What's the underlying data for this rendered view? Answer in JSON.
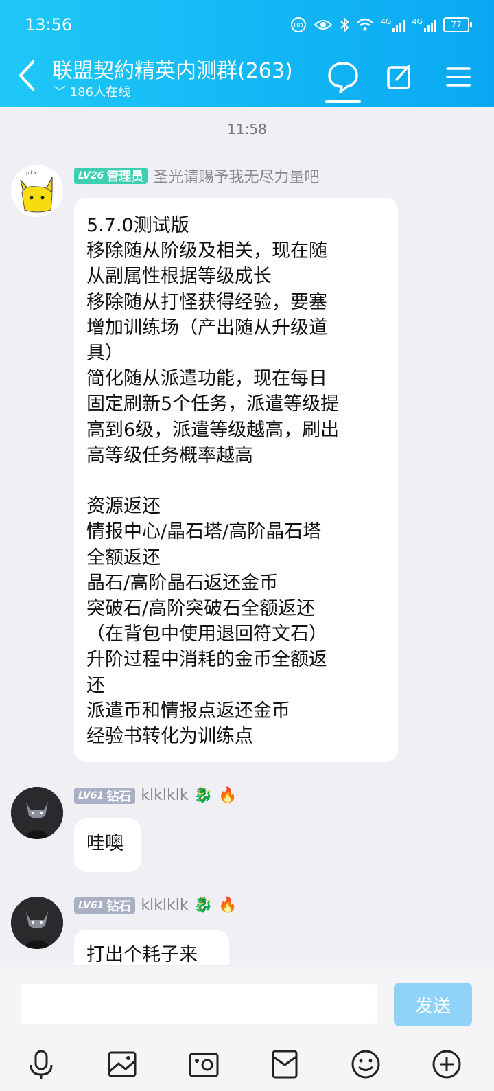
{
  "status_bar": {
    "time": "13:56",
    "battery": "77",
    "net1": "4G",
    "net2": "4G"
  },
  "header": {
    "title": "联盟契約精英内测群(263)",
    "online": "186人在线"
  },
  "chat": {
    "timestamp": "11:58",
    "messages": [
      {
        "level": "LV26",
        "role": "管理员",
        "name": "圣光请赐予我无尽力量吧",
        "text": "5.7.0测试版\n移除随从阶级及相关，现在随\n从副属性根据等级成长\n移除随从打怪获得经验，要塞\n增加训练场（产出随从升级道\n具）\n简化随从派遣功能，现在每日\n固定刷新5个任务，派遣等级提\n高到6级，派遣等级越高，刷出\n高等级任务概率越高\n\n资源返还\n情报中心/晶石塔/高阶晶石塔\n全额返还\n晶石/高阶晶石返还金币\n突破石/高阶突破石全额返还\n（在背包中使用退回符文石）\n升阶过程中消耗的金币全额返\n还\n派遣币和情报点返还金币\n经验书转化为训练点"
      },
      {
        "level": "LV61",
        "role": "钻石",
        "name": "klklklk",
        "text": "哇噢"
      },
      {
        "level": "LV61",
        "role": "钻石",
        "name": "klklklk",
        "text": "打出个耗子来"
      }
    ]
  },
  "input": {
    "placeholder": "",
    "send_label": "发送"
  },
  "colors": {
    "header": "#12b7f5",
    "admin_badge": "#3cd0b1",
    "member_badge": "#a9b0c6",
    "send": "#8fd3fa"
  }
}
